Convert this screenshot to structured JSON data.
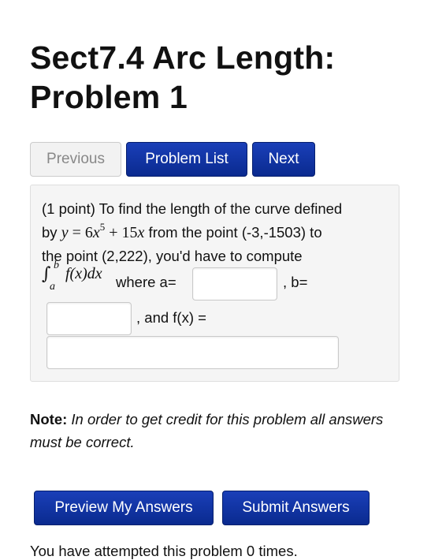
{
  "page": {
    "title_line1": "Sect7.4 Arc Length:",
    "title_line2": "Problem 1"
  },
  "nav": {
    "previous": "Previous",
    "problem_list": "Problem List",
    "next": "Next"
  },
  "problem": {
    "line1": "(1 point) To find the length of the curve defined",
    "line2_prefix": "by ",
    "equation_lhs": "y",
    "equation_eq": " = ",
    "equation_coef": "6",
    "equation_var": "x",
    "equation_exp": "5",
    "equation_plus": " + ",
    "equation_term2": "15",
    "equation_var2": "x",
    "line2_suffix": " from the point (-3,-1503) to",
    "line3": "the point (2,222), you'd have to compute",
    "integral_sign": "∫",
    "integral_upper": "b",
    "integral_lower": "a",
    "integrand": "f(x)dx",
    "where_a": " where a=",
    "label_b": ", b=",
    "label_fx": ", and f(x) =",
    "answer_a": "",
    "answer_b": "",
    "answer_fx": ""
  },
  "note": {
    "label": "Note:",
    "text": " In order to get credit for this problem all answers must be correct."
  },
  "actions": {
    "preview": "Preview My Answers",
    "submit": "Submit Answers"
  },
  "status": {
    "attempts": "You have attempted this problem 0 times."
  }
}
